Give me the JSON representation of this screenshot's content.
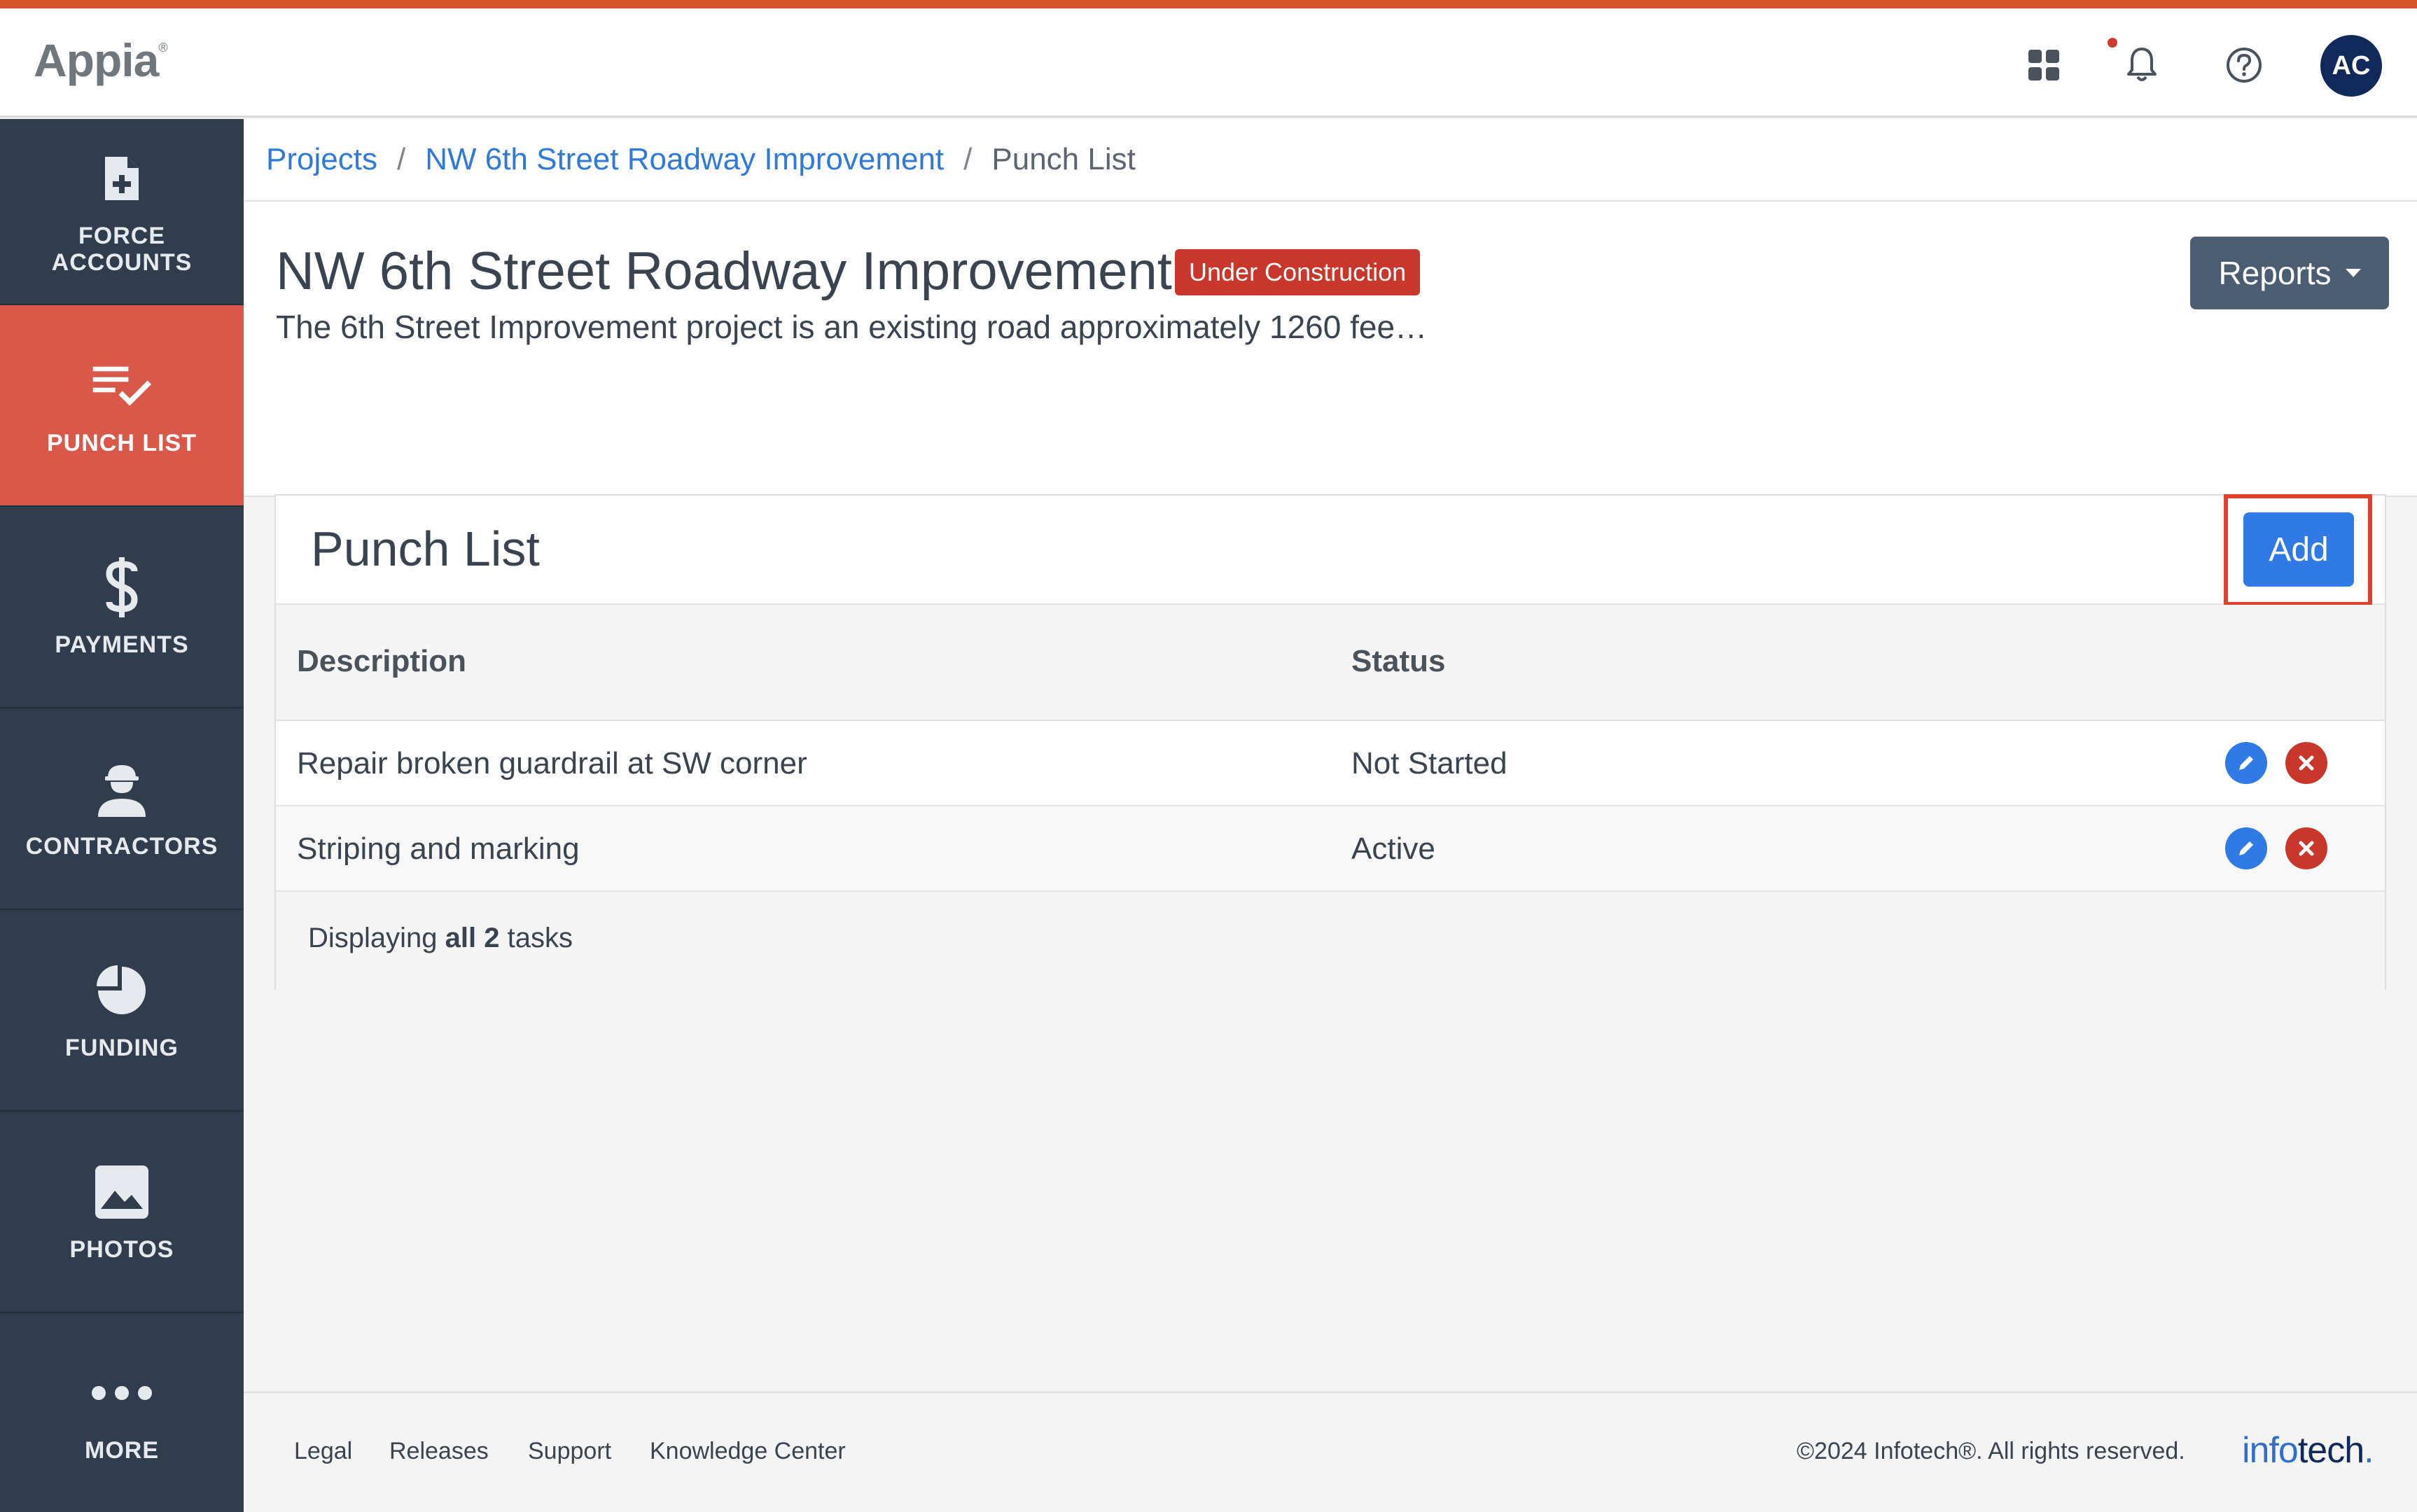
{
  "app": {
    "logo": "Appia",
    "logo_mark": "®",
    "user_initials": "AC"
  },
  "header_icons": [
    "apps-grid-icon",
    "bell-icon",
    "help-icon"
  ],
  "sidebar": {
    "items": [
      {
        "label_line1": "FORCE",
        "label_line2": "ACCOUNTS",
        "icon": "file-plus-icon",
        "active": false
      },
      {
        "label": "PUNCH LIST",
        "icon": "checklist-icon",
        "active": true
      },
      {
        "label": "PAYMENTS",
        "icon": "dollar-icon",
        "active": false
      },
      {
        "label": "CONTRACTORS",
        "icon": "worker-icon",
        "active": false
      },
      {
        "label": "FUNDING",
        "icon": "pie-chart-icon",
        "active": false
      },
      {
        "label": "PHOTOS",
        "icon": "image-icon",
        "active": false
      },
      {
        "label": "MORE",
        "icon": "more-dots-icon",
        "active": false
      }
    ]
  },
  "breadcrumb": {
    "items": [
      "Projects",
      "NW 6th Street Roadway Improvement",
      "Punch List"
    ],
    "separator": "/"
  },
  "project": {
    "title": "NW 6th Street Roadway Improvement",
    "status": "Under Construction",
    "description": "The 6th Street Improvement project is an existing road approximately 1260 fee…",
    "reports_label": "Reports"
  },
  "punch_list": {
    "title": "Punch List",
    "add_label": "Add",
    "columns": [
      "Description",
      "Status"
    ],
    "rows": [
      {
        "description": "Repair broken guardrail at SW corner",
        "status": "Not Started"
      },
      {
        "description": "Striping and marking",
        "status": "Active"
      }
    ],
    "footer_prefix": "Displaying",
    "footer_bold": "all 2",
    "footer_suffix": "tasks"
  },
  "footer": {
    "links": [
      "Legal",
      "Releases",
      "Support",
      "Knowledge Center"
    ],
    "copyright": "©2024 Infotech®. All rights reserved.",
    "brand_part1": "info",
    "brand_part2": "tech",
    "brand_dot": "."
  },
  "colors": {
    "accent_orange": "#d4542a",
    "sidebar_bg": "#2f3d4e",
    "active_nav": "#d9584a",
    "primary_blue": "#2f7ae4",
    "danger_red": "#c9362b",
    "highlight_box": "#e0412b"
  }
}
